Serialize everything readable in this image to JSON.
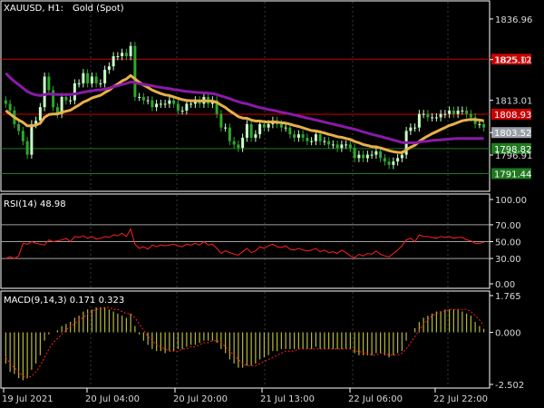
{
  "header": {
    "symbol": "XAUUSD, H1:",
    "name": "Gold (Spot)"
  },
  "colors": {
    "bg": "#000000",
    "frame": "#ffffff",
    "grid": "#2f3f2f",
    "bull": "#c8ffc8",
    "bear": "#2ea82e",
    "ma_fast": "#e8b04a",
    "ma_slow": "#8a1aa8",
    "resist": "#cc0000",
    "support": "#1f7a1f",
    "price_tag": "#9aa0a8",
    "rsi_line": "#ff2020",
    "rsi_level": "#a0a0a0",
    "macd_hist": "#b8b83a",
    "macd_signal": "#ff2020"
  },
  "chart_data": [
    {
      "type": "candlestick",
      "title": "XAUUSD, H1:  Gold (Spot)",
      "ylim": [
        1786.5,
        1842.0
      ],
      "y_ticks": [
        "1836.96",
        "1825.01",
        "1813.01",
        "1803.52",
        "1796.91"
      ],
      "x_ticks": [
        "19 Jul 2021",
        "20 Jul 04:00",
        "20 Jul 20:00",
        "21 Jul 13:00",
        "22 Jul 06:00",
        "22 Jul 22:00"
      ],
      "ohlc_close": [
        1812,
        1810,
        1806,
        1804,
        1801,
        1797,
        1806,
        1807,
        1811,
        1820,
        1816,
        1811,
        1809,
        1814,
        1813,
        1813,
        1818,
        1818,
        1821,
        1818,
        1820,
        1818,
        1818,
        1822,
        1823,
        1826,
        1826,
        1827,
        1826,
        1829,
        1814,
        1814,
        1813,
        1813,
        1811,
        1812,
        1812,
        1812,
        1813,
        1812,
        1810,
        1810,
        1812,
        1812,
        1813,
        1812,
        1814,
        1812,
        1813,
        1809,
        1805,
        1805,
        1801,
        1800,
        1799,
        1802,
        1806,
        1802,
        1803,
        1806,
        1805,
        1806,
        1807,
        1806,
        1805,
        1805,
        1803,
        1802,
        1803,
        1802,
        1801,
        1801,
        1803,
        1801,
        1801,
        1800,
        1800,
        1799,
        1800,
        1800,
        1799,
        1796,
        1797,
        1796,
        1797,
        1797,
        1798,
        1796,
        1795,
        1794,
        1795,
        1796,
        1797,
        1804,
        1805,
        1805,
        1809,
        1809,
        1808,
        1808,
        1808,
        1809,
        1809,
        1810,
        1809,
        1810,
        1810,
        1809,
        1808,
        1806,
        1806,
        1805
      ],
      "series": [
        {
          "name": "Moving Average (fast)",
          "values": [
            1810.0,
            1809.0,
            1808.0,
            1807.2,
            1806.5,
            1805.5,
            1805.5,
            1805.7,
            1806.3,
            1808.0,
            1808.8,
            1809.0,
            1809.0,
            1809.5,
            1809.8,
            1810.1,
            1810.9,
            1811.6,
            1812.5,
            1813.0,
            1813.7,
            1814.1,
            1814.5,
            1815.3,
            1816.0,
            1817.0,
            1817.8,
            1818.7,
            1819.3,
            1820.3,
            1819.3,
            1818.3,
            1817.5,
            1816.8,
            1816.0,
            1815.5,
            1815.0,
            1814.6,
            1814.4,
            1814.0,
            1813.6,
            1813.2,
            1813.0,
            1812.9,
            1812.9,
            1812.8,
            1812.9,
            1812.8,
            1812.8,
            1812.4,
            1811.6,
            1810.9,
            1809.9,
            1809.1,
            1808.2,
            1807.8,
            1807.7,
            1807.2,
            1806.9,
            1806.9,
            1806.7,
            1806.6,
            1806.7,
            1806.6,
            1806.4,
            1806.3,
            1806.0,
            1805.6,
            1805.3,
            1804.9,
            1804.5,
            1804.1,
            1804.0,
            1803.7,
            1803.4,
            1803.0,
            1802.7,
            1802.3,
            1802.1,
            1801.8,
            1801.5,
            1800.9,
            1800.5,
            1800.0,
            1799.7,
            1799.4,
            1799.3,
            1799.0,
            1798.6,
            1798.2,
            1797.9,
            1797.7,
            1797.6,
            1798.4,
            1799.2,
            1799.8,
            1800.9,
            1801.8,
            1802.5,
            1803.2,
            1803.8,
            1804.4,
            1805.0,
            1805.6,
            1806.0,
            1806.5,
            1807.0,
            1807.2,
            1807.4,
            1807.3,
            1807.2,
            1807.0
          ]
        },
        {
          "name": "Moving Average (slow)",
          "values": [
            1821.0,
            1819.7,
            1818.6,
            1817.6,
            1816.6,
            1815.6,
            1815.0,
            1814.6,
            1814.4,
            1814.7,
            1814.9,
            1814.8,
            1814.7,
            1814.7,
            1814.7,
            1814.7,
            1814.9,
            1815.1,
            1815.4,
            1815.6,
            1815.8,
            1816.0,
            1816.1,
            1816.3,
            1816.6,
            1817.0,
            1817.3,
            1817.7,
            1818.0,
            1818.4,
            1818.2,
            1817.9,
            1817.7,
            1817.5,
            1817.3,
            1817.0,
            1816.8,
            1816.6,
            1816.4,
            1816.2,
            1816.0,
            1815.8,
            1815.6,
            1815.5,
            1815.4,
            1815.3,
            1815.2,
            1815.1,
            1815.0,
            1814.7,
            1814.3,
            1813.9,
            1813.5,
            1813.0,
            1812.6,
            1812.2,
            1812.0,
            1811.6,
            1811.2,
            1810.9,
            1810.6,
            1810.3,
            1810.1,
            1809.8,
            1809.5,
            1809.3,
            1809.0,
            1808.7,
            1808.4,
            1808.1,
            1807.8,
            1807.5,
            1807.2,
            1806.9,
            1806.6,
            1806.3,
            1806.0,
            1805.7,
            1805.4,
            1805.1,
            1804.8,
            1804.5,
            1804.1,
            1803.7,
            1803.4,
            1803.0,
            1802.7,
            1802.4,
            1802.0,
            1801.7,
            1801.3,
            1801.0,
            1800.6,
            1800.6,
            1800.5,
            1800.5,
            1800.7,
            1800.9,
            1801.0,
            1801.2,
            1801.3,
            1801.4,
            1801.5,
            1801.6,
            1801.7,
            1801.8,
            1801.8,
            1801.8,
            1801.8,
            1801.8,
            1801.8,
            1801.8
          ]
        }
      ],
      "levels": [
        {
          "label": "1825.12",
          "value": 1825.12,
          "kind": "resistance"
        },
        {
          "label": "1808.93",
          "value": 1808.93,
          "kind": "resistance"
        },
        {
          "label": "1803.52",
          "value": 1803.52,
          "kind": "current"
        },
        {
          "label": "1798.82",
          "value": 1798.82,
          "kind": "support"
        },
        {
          "label": "1791.44",
          "value": 1791.44,
          "kind": "support"
        }
      ]
    },
    {
      "type": "line",
      "title": "RSI(14) 48.98",
      "ylim": [
        0,
        100
      ],
      "y_ticks": [
        "100.00",
        "70.00",
        "50.00",
        "30.00",
        "0.00"
      ],
      "levels": [
        70,
        50,
        30
      ],
      "series": [
        {
          "name": "RSI(14)",
          "values": [
            30,
            32,
            30,
            33,
            48,
            47,
            50,
            48,
            47,
            46,
            52,
            50,
            51,
            52,
            54,
            50,
            56,
            55,
            57,
            54,
            56,
            53,
            54,
            56,
            55,
            58,
            57,
            60,
            56,
            65,
            47,
            42,
            44,
            41,
            46,
            44,
            46,
            45,
            46,
            47,
            45,
            44,
            47,
            46,
            48,
            46,
            50,
            46,
            47,
            42,
            36,
            39,
            37,
            35,
            34,
            38,
            42,
            37,
            39,
            44,
            42,
            45,
            47,
            44,
            43,
            45,
            41,
            40,
            42,
            40,
            39,
            40,
            42,
            38,
            40,
            37,
            38,
            36,
            40,
            37,
            33,
            31,
            35,
            33,
            36,
            35,
            39,
            35,
            33,
            32,
            36,
            40,
            45,
            52,
            54,
            50,
            58,
            56,
            56,
            55,
            54,
            56,
            55,
            56,
            54,
            55,
            55,
            52,
            51,
            48,
            48,
            49
          ]
        }
      ]
    },
    {
      "type": "bar",
      "title": "MACD(9,14,3) 0.171 0.323",
      "ylim": [
        -2.502,
        1.765
      ],
      "y_ticks": [
        "1.765",
        "0.000",
        "-2.502"
      ],
      "series": [
        {
          "name": "MACD",
          "values": [
            -1.5,
            -1.9,
            -2.0,
            -2.2,
            -2.3,
            -2.2,
            -1.8,
            -1.5,
            -1.1,
            -0.4,
            -0.1,
            0.0,
            0.1,
            0.3,
            0.4,
            0.5,
            0.7,
            0.8,
            1.0,
            1.1,
            1.1,
            1.2,
            1.2,
            1.2,
            1.1,
            1.0,
            0.9,
            0.8,
            0.7,
            0.9,
            0.3,
            -0.1,
            -0.4,
            -0.6,
            -0.8,
            -0.9,
            -0.9,
            -1.0,
            -0.9,
            -0.9,
            -0.8,
            -0.8,
            -0.7,
            -0.6,
            -0.6,
            -0.5,
            -0.4,
            -0.4,
            -0.4,
            -0.5,
            -0.8,
            -1.0,
            -1.3,
            -1.5,
            -1.7,
            -1.7,
            -1.6,
            -1.6,
            -1.5,
            -1.3,
            -1.2,
            -1.1,
            -0.9,
            -0.9,
            -0.8,
            -0.8,
            -0.8,
            -0.8,
            -0.8,
            -0.8,
            -0.8,
            -0.8,
            -0.7,
            -0.8,
            -0.8,
            -0.8,
            -0.8,
            -0.8,
            -0.8,
            -0.8,
            -0.8,
            -1.0,
            -1.1,
            -1.1,
            -1.1,
            -1.1,
            -1.0,
            -1.0,
            -1.1,
            -1.2,
            -1.1,
            -1.0,
            -0.9,
            -0.4,
            0.0,
            0.2,
            0.5,
            0.7,
            0.8,
            0.9,
            1.0,
            1.0,
            1.1,
            1.1,
            1.1,
            1.1,
            1.0,
            0.9,
            0.8,
            0.5,
            0.3,
            0.17
          ]
        },
        {
          "name": "Signal",
          "values": [
            -1.2,
            -1.5,
            -1.7,
            -1.9,
            -2.1,
            -2.2,
            -2.1,
            -1.9,
            -1.6,
            -1.2,
            -0.8,
            -0.5,
            -0.3,
            -0.1,
            0.1,
            0.3,
            0.4,
            0.6,
            0.7,
            0.9,
            1.0,
            1.1,
            1.1,
            1.2,
            1.2,
            1.1,
            1.1,
            1.0,
            0.9,
            0.9,
            0.7,
            0.4,
            0.1,
            -0.2,
            -0.4,
            -0.6,
            -0.7,
            -0.8,
            -0.9,
            -0.9,
            -0.9,
            -0.8,
            -0.8,
            -0.7,
            -0.7,
            -0.6,
            -0.5,
            -0.5,
            -0.4,
            -0.4,
            -0.5,
            -0.7,
            -0.9,
            -1.1,
            -1.3,
            -1.5,
            -1.6,
            -1.6,
            -1.6,
            -1.5,
            -1.4,
            -1.3,
            -1.2,
            -1.1,
            -1.0,
            -0.9,
            -0.9,
            -0.9,
            -0.8,
            -0.8,
            -0.8,
            -0.8,
            -0.8,
            -0.8,
            -0.8,
            -0.8,
            -0.8,
            -0.8,
            -0.8,
            -0.8,
            -0.8,
            -0.9,
            -0.9,
            -1.0,
            -1.0,
            -1.1,
            -1.1,
            -1.0,
            -1.0,
            -1.1,
            -1.1,
            -1.1,
            -1.0,
            -0.8,
            -0.5,
            -0.2,
            0.1,
            0.4,
            0.6,
            0.8,
            0.9,
            1.0,
            1.0,
            1.1,
            1.1,
            1.1,
            1.1,
            1.1,
            1.0,
            0.8,
            0.6,
            0.32
          ]
        }
      ]
    }
  ]
}
